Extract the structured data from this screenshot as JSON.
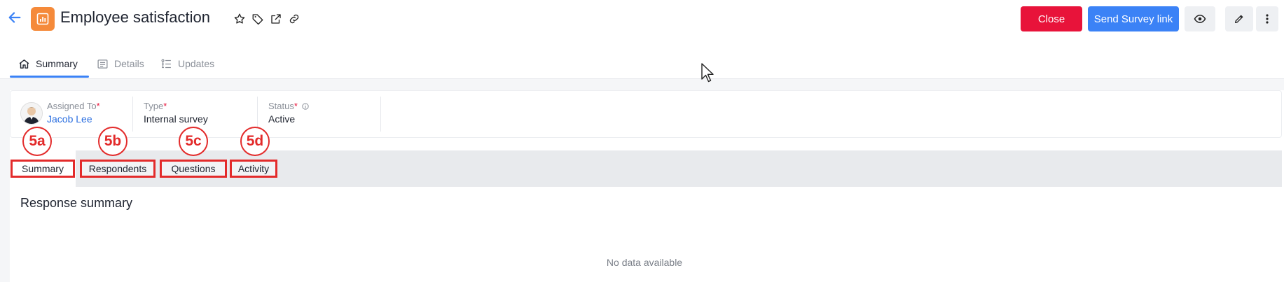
{
  "header": {
    "title": "Employee satisfaction",
    "close_label": "Close",
    "send_label": "Send Survey link",
    "icons": [
      "arrow-left-icon",
      "report-icon",
      "star-icon",
      "tag-icon",
      "external-link-icon",
      "link-icon",
      "eye-icon",
      "pencil-icon",
      "more-vertical-icon"
    ],
    "accent": "#3b82f6",
    "danger": "#e8133a",
    "app_icon_color": "#f58a3a"
  },
  "top_tabs": [
    {
      "label": "Summary",
      "active": true
    },
    {
      "label": "Details",
      "active": false
    },
    {
      "label": "Updates",
      "active": false
    }
  ],
  "fields": {
    "assigned_label": "Assigned To",
    "assigned_value": "Jacob Lee",
    "type_label": "Type",
    "type_value": "Internal survey",
    "status_label": "Status",
    "status_value": "Active",
    "required_mark": "*"
  },
  "inner_tabs": [
    {
      "label": "Summary",
      "badge": "5a",
      "active": true
    },
    {
      "label": "Respondents",
      "badge": "5b",
      "active": false
    },
    {
      "label": "Questions",
      "badge": "5c",
      "active": false
    },
    {
      "label": "Activity",
      "badge": "5d",
      "active": false
    }
  ],
  "content": {
    "section_title": "Response summary",
    "empty_message": "No data available"
  }
}
